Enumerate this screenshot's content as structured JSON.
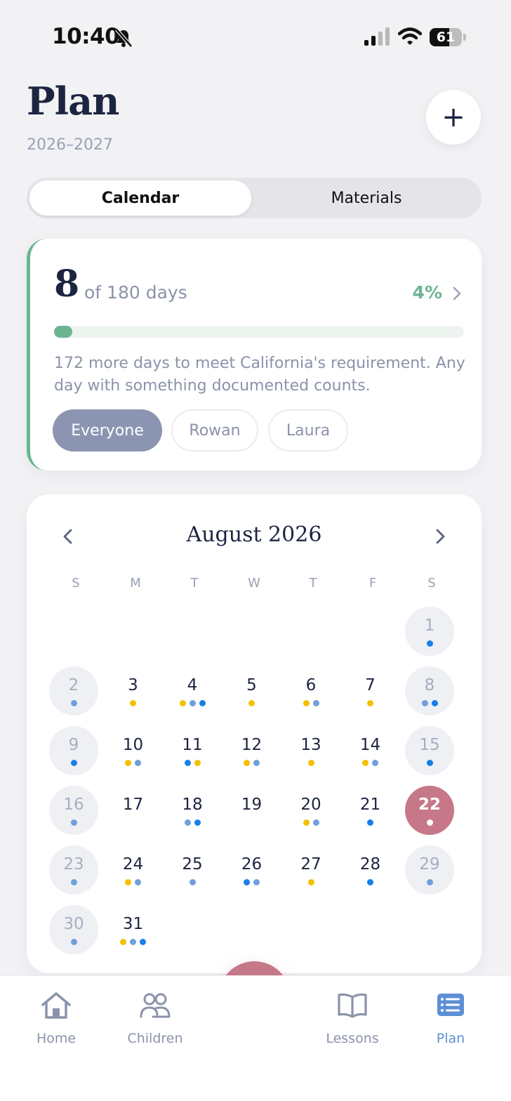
{
  "status_bar": {
    "time": "10:40",
    "battery": "61",
    "battery_level": 0.61
  },
  "header": {
    "title": "Plan",
    "year_range": "2026–2027",
    "add_label": "+"
  },
  "view_toggle": {
    "active": "Calendar",
    "inactive": "Materials"
  },
  "progress": {
    "days_done": "8",
    "days_total_text": "of 180 days",
    "percent": "4%",
    "completion_fraction": 0.044,
    "requirement_text": "172 more days to meet California's requirement. Any day with something documented counts.",
    "filters": [
      "Everyone",
      "Rowan",
      "Laura"
    ],
    "active_filter": "Everyone"
  },
  "calendar": {
    "month_label": "August 2026",
    "weekdays": [
      "S",
      "M",
      "T",
      "W",
      "T",
      "F",
      "S"
    ],
    "first_weekday_index": 6,
    "today": 22,
    "colors": {
      "yellow": "#f5c000",
      "light_blue": "#6f9fdc",
      "blue": "#1a7ee8",
      "today_dot": "#ffffff"
    },
    "days": [
      {
        "n": "1",
        "dots": [
          "blue"
        ]
      },
      {
        "n": "2",
        "dots": [
          "light_blue"
        ]
      },
      {
        "n": "3",
        "dots": [
          "yellow"
        ]
      },
      {
        "n": "4",
        "dots": [
          "yellow",
          "light_blue",
          "blue"
        ]
      },
      {
        "n": "5",
        "dots": [
          "yellow"
        ]
      },
      {
        "n": "6",
        "dots": [
          "yellow",
          "light_blue"
        ]
      },
      {
        "n": "7",
        "dots": [
          "yellow"
        ]
      },
      {
        "n": "8",
        "dots": [
          "light_blue",
          "blue"
        ]
      },
      {
        "n": "9",
        "dots": [
          "blue"
        ]
      },
      {
        "n": "10",
        "dots": [
          "yellow",
          "light_blue"
        ]
      },
      {
        "n": "11",
        "dots": [
          "blue",
          "yellow"
        ]
      },
      {
        "n": "12",
        "dots": [
          "yellow",
          "light_blue"
        ]
      },
      {
        "n": "13",
        "dots": [
          "yellow"
        ]
      },
      {
        "n": "14",
        "dots": [
          "yellow",
          "light_blue"
        ]
      },
      {
        "n": "15",
        "dots": [
          "blue"
        ]
      },
      {
        "n": "16",
        "dots": [
          "light_blue"
        ]
      },
      {
        "n": "17",
        "dots": []
      },
      {
        "n": "18",
        "dots": [
          "light_blue",
          "blue"
        ]
      },
      {
        "n": "19",
        "dots": []
      },
      {
        "n": "20",
        "dots": [
          "yellow",
          "light_blue"
        ]
      },
      {
        "n": "21",
        "dots": [
          "blue"
        ]
      },
      {
        "n": "22",
        "dots": [
          "today_dot"
        ]
      },
      {
        "n": "23",
        "dots": [
          "light_blue"
        ]
      },
      {
        "n": "24",
        "dots": [
          "yellow",
          "light_blue"
        ]
      },
      {
        "n": "25",
        "dots": [
          "light_blue"
        ]
      },
      {
        "n": "26",
        "dots": [
          "blue",
          "light_blue"
        ]
      },
      {
        "n": "27",
        "dots": [
          "yellow"
        ]
      },
      {
        "n": "28",
        "dots": [
          "blue"
        ]
      },
      {
        "n": "29",
        "dots": [
          "light_blue"
        ]
      },
      {
        "n": "30",
        "dots": [
          "light_blue"
        ]
      },
      {
        "n": "31",
        "dots": [
          "yellow",
          "light_blue",
          "blue"
        ]
      }
    ]
  },
  "tabbar": {
    "items": [
      {
        "label": "Home",
        "icon": "home-icon"
      },
      {
        "label": "Children",
        "icon": "children-icon"
      },
      {
        "label": "Lessons",
        "icon": "book-icon"
      },
      {
        "label": "Plan",
        "icon": "plan-list-icon"
      }
    ],
    "active": "Plan",
    "fab_icon": "plus-icon"
  },
  "theme": {
    "accent_green": "#6db592",
    "accent_rose": "#c67788",
    "accent_blue": "#5e8fd6"
  }
}
